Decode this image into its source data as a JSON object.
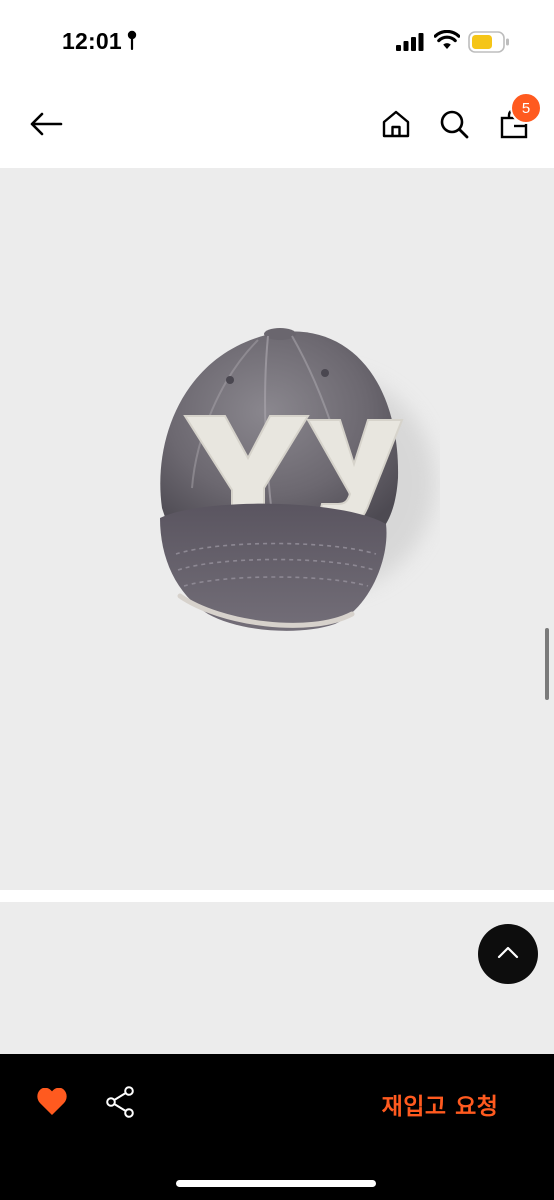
{
  "status_bar": {
    "time": "12:01",
    "pin_icon": "location-pin-icon",
    "signal_icon": "cellular-signal-icon",
    "wifi_icon": "wifi-icon",
    "battery_icon": "battery-icon",
    "battery_color": "#f5c518"
  },
  "header": {
    "back_icon": "arrow-left-icon",
    "home_icon": "home-icon",
    "search_icon": "search-icon",
    "cart_icon": "shopping-bag-icon",
    "cart_count": "5",
    "badge_color": "#ff5a1f"
  },
  "product": {
    "image_icon": "baseball-cap-image",
    "cap_lettering": "Yy",
    "background_color": "#ececec"
  },
  "floating": {
    "scroll_top_icon": "chevron-up-icon"
  },
  "bottom_bar": {
    "like_icon": "heart-icon",
    "share_icon": "share-icon",
    "restock_label": "재입고 요청",
    "accent_color": "#ff5a1f"
  }
}
